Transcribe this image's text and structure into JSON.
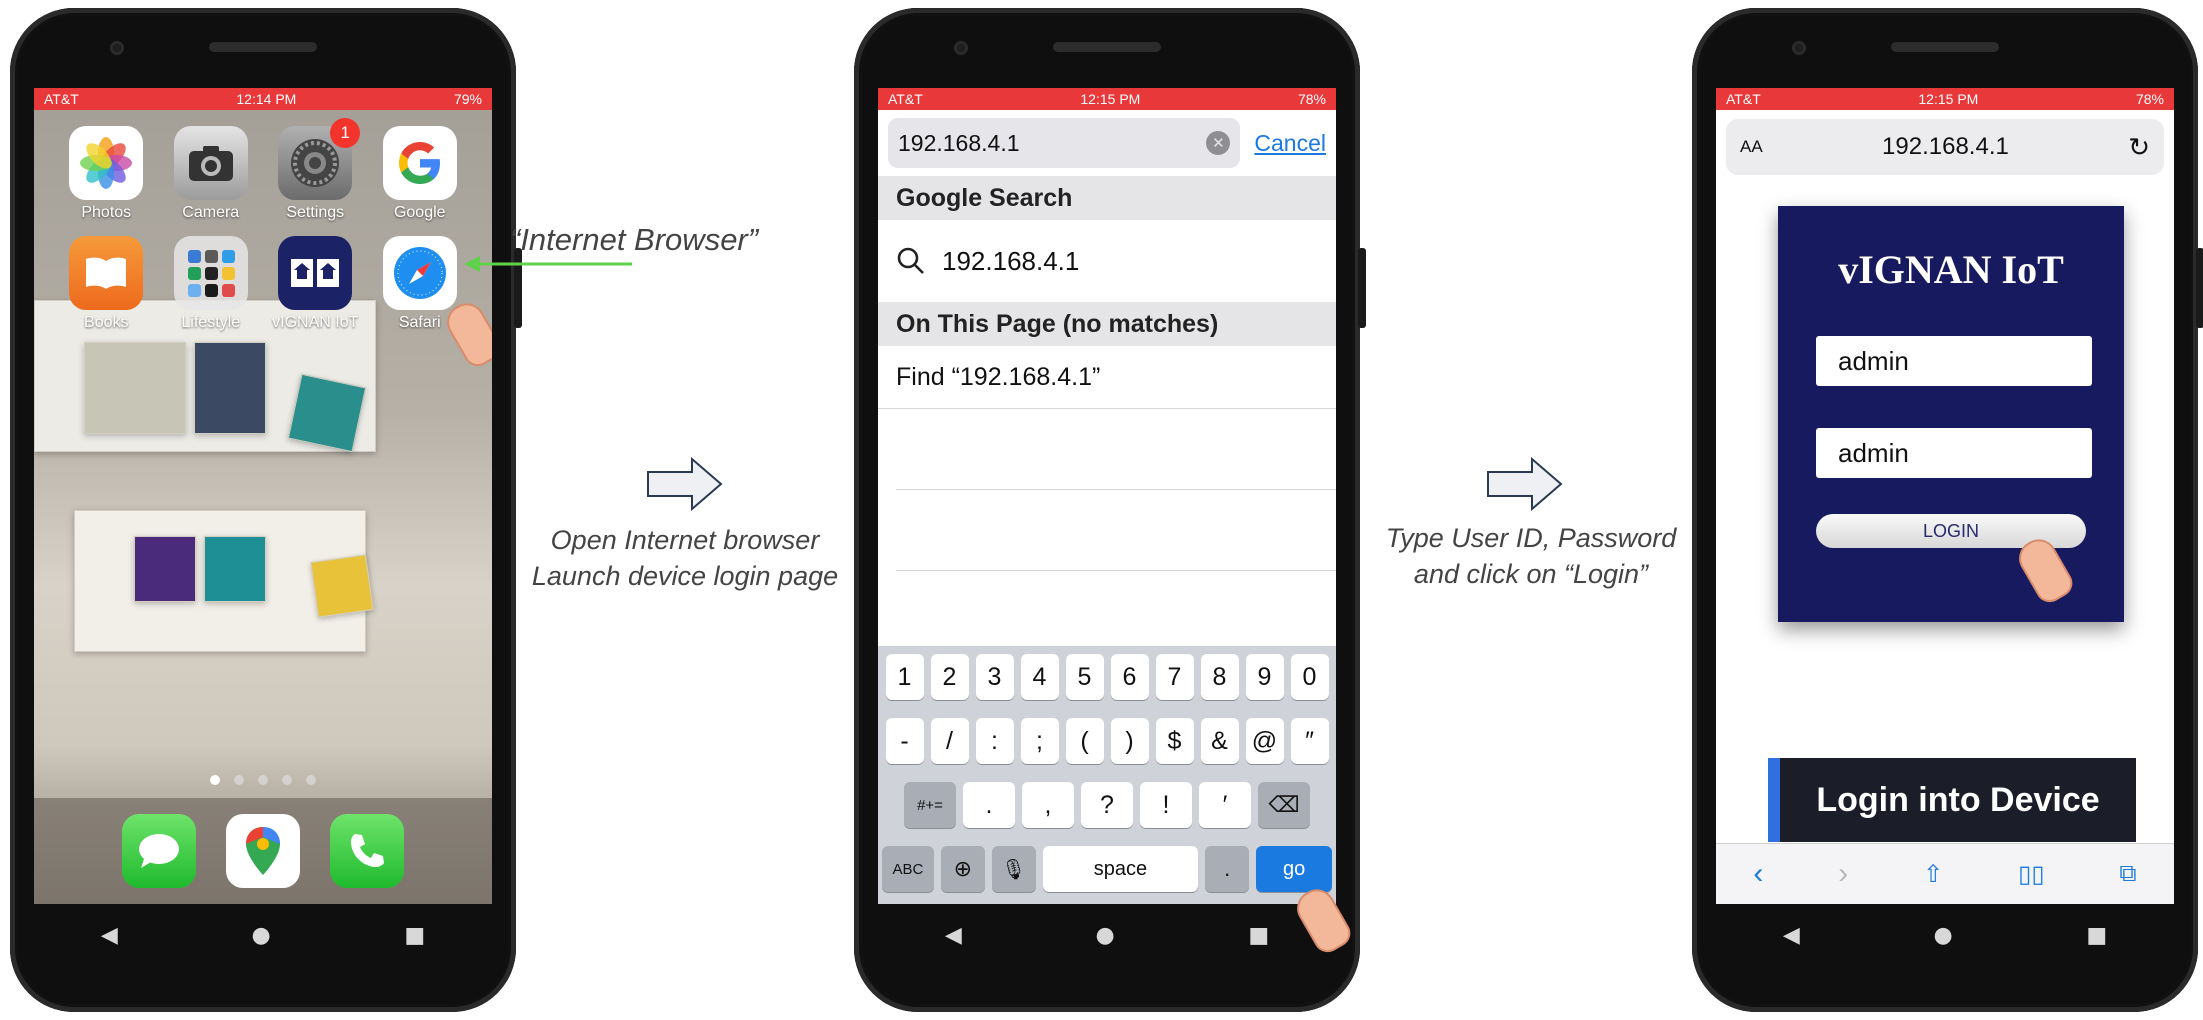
{
  "phone1": {
    "status": {
      "carrier": "AT&T",
      "time": "12:14 PM",
      "battery": "79%"
    },
    "apps": [
      {
        "label": "Photos",
        "icon": "photos-icon"
      },
      {
        "label": "Camera",
        "icon": "camera-icon"
      },
      {
        "label": "Settings",
        "icon": "settings-icon",
        "badge": "1"
      },
      {
        "label": "Google",
        "icon": "google-icon"
      },
      {
        "label": "Books",
        "icon": "books-icon"
      },
      {
        "label": "Lifestyle",
        "icon": "folder-icon"
      },
      {
        "label": "vIGNAN IoT",
        "icon": "vignan-iot-icon"
      },
      {
        "label": "Safari",
        "icon": "safari-icon"
      }
    ],
    "annotation": "“Internet Browser”"
  },
  "step1": {
    "line1": "Open Internet browser",
    "line2": "Launch device login page"
  },
  "phone2": {
    "status": {
      "carrier": "AT&T",
      "time": "12:15 PM",
      "battery": "78%"
    },
    "search_value": "192.168.4.1",
    "cancel": "Cancel",
    "google_header": "Google Search",
    "suggestion": "192.168.4.1",
    "on_page_header": "On This Page (no matches)",
    "find_row": "Find “192.168.4.1”",
    "keyboard": {
      "row1": [
        "1",
        "2",
        "3",
        "4",
        "5",
        "6",
        "7",
        "8",
        "9",
        "0"
      ],
      "row2": [
        "-",
        "/",
        ":",
        ";",
        "(",
        ")",
        "$",
        "&",
        "@",
        "″"
      ],
      "row3_mode": "#+=",
      "row3": [
        ".",
        ",",
        "?",
        "!",
        "′"
      ],
      "abc": "ABC",
      "space": "space",
      "dot": ".",
      "go": "go"
    }
  },
  "step2": {
    "line1": "Type User ID, Password",
    "line2": "and click on “Login”"
  },
  "phone3": {
    "status": {
      "carrier": "AT&T",
      "time": "12:15 PM",
      "battery": "78%"
    },
    "text_size": "AA",
    "url": "192.168.4.1",
    "card_title": "vIGNAN IoT",
    "user_value": "admin",
    "password_value": "admin",
    "login_label": "LOGIN",
    "caption": "Login into Device"
  },
  "colors": {
    "status_bar": "#e8383a",
    "ios_blue": "#1a7ae0",
    "card_bg": "#171a5e",
    "caption_accent": "#2f6fe0"
  }
}
